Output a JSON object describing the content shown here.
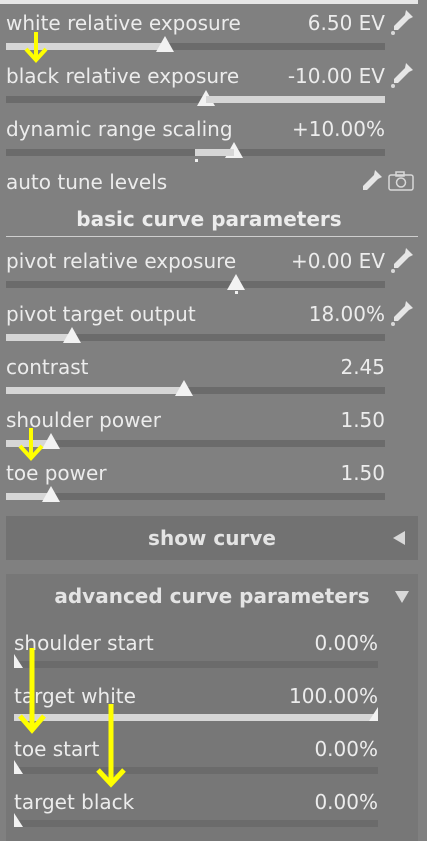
{
  "top_sliders": [
    {
      "label": "white relative exposure",
      "value": "6.50 EV",
      "fill": 0.42,
      "picker": true
    },
    {
      "label": "black relative exposure",
      "value": "-10.00 EV",
      "fill": 0.5,
      "picker": true
    },
    {
      "label": "dynamic range scaling",
      "value": "+10.00%",
      "fill": 0.6,
      "picker": false
    }
  ],
  "auto_tune": {
    "label": "auto tune levels",
    "picker_icon": "color-picker-icon",
    "camera_icon": "camera-icon"
  },
  "basic_section": {
    "title": "basic curve parameters"
  },
  "basic_sliders": [
    {
      "label": "pivot relative exposure",
      "value": "+0.00 EV",
      "fill": 0.5,
      "picker": true
    },
    {
      "label": "pivot target output",
      "value": "18.00%",
      "fill": 0.175,
      "picker": true
    },
    {
      "label": "contrast",
      "value": "2.45",
      "fill": 0.47,
      "picker": false
    },
    {
      "label": "shoulder power",
      "value": "1.50",
      "fill": 0.12,
      "picker": false
    },
    {
      "label": "toe power",
      "value": "1.50",
      "fill": 0.12,
      "picker": false
    }
  ],
  "show_curve": {
    "label": "show curve",
    "arrow_icon": "triangle-left-icon"
  },
  "advanced_section": {
    "title": "advanced curve parameters",
    "arrow_icon": "triangle-down-icon"
  },
  "advanced_sliders": [
    {
      "label": "shoulder start",
      "value": "0.00%",
      "fill": 0.0
    },
    {
      "label": "target white",
      "value": "100.00%",
      "fill": 1.0
    },
    {
      "label": "toe start",
      "value": "0.00%",
      "fill": 0.0
    },
    {
      "label": "target black",
      "value": "0.00%",
      "fill": 0.0
    }
  ],
  "colors": {
    "accent_arrow": "#ffff00",
    "panel_bg": "#808080",
    "track": "#6b6b6b",
    "fill": "#d6d6d6"
  }
}
